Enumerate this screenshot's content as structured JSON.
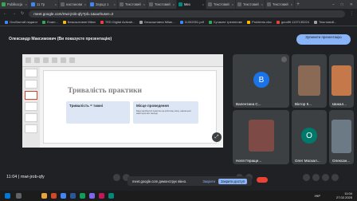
{
  "browser": {
    "tabs": [
      {
        "title": "Publikacja",
        "color": "#34a853"
      },
      {
        "title": "11 Тр",
        "color": "#4285f4"
      },
      {
        "title": "настанови",
        "color": "#5f6368"
      },
      {
        "title": "Зерщо 1",
        "color": "#4285f4"
      },
      {
        "title": "Текстовий",
        "color": "#5f6368"
      },
      {
        "title": "Текстовий",
        "color": "#5f6368"
      },
      {
        "title": "Мез",
        "color": "#00897b",
        "active": true
      },
      {
        "title": "Текстовий",
        "color": "#5f6368"
      },
      {
        "title": "Текстовий",
        "color": "#5f6368"
      },
      {
        "title": "Текстовий",
        "color": "#5f6368"
      }
    ],
    "url": "meet.google.com/mwi-jrob-qfy?pli=1&authuser=2",
    "bookmarks": [
      "Особистий педагог",
      "Exam...",
      "Безкоштовне Milan",
      "TED Digital Activati...",
      "Безкоштовна Milan...",
      "11002051.pdf",
      "Сучасне тренінгове",
      "Problems.xlsx",
      "goodfit 1137135224",
      "Текстовий..."
    ]
  },
  "banner": {
    "text": "Олександр Максимович (Ви показуєте презентацію)",
    "stop_button": "Зупинити презентацію"
  },
  "presentation": {
    "slide_title": "Тривалість практики",
    "card_left_title": "Тривалість = тижні",
    "card_right_title": "Місце проведення",
    "card_right_text": "База виробничої практики на робочому місці, навчальної майстерні або закладі"
  },
  "participants": [
    {
      "name": "Валентина С...",
      "type": "avatar",
      "letter": "B",
      "avatar_color": "#1a73e8"
    },
    {
      "name": "Віктор К...",
      "type": "photo",
      "photo_color": "#8a6a55"
    },
    {
      "name": "Шикал...",
      "type": "photo",
      "photo_color": "#c5784a"
    },
    {
      "name": "Неля Гераще...",
      "type": "photo",
      "photo_color": "#7d4a45"
    },
    {
      "name": "Олег Москал...",
      "type": "avatar",
      "letter": "O",
      "avatar_color": "#00796b"
    },
    {
      "name": "Олексан...",
      "type": "photo",
      "photo_color": "#6c7a86"
    }
  ],
  "controls": {
    "meeting_time": "11:04",
    "meeting_code": "mwi-jrob-qfy",
    "toast_text": "meet.google.com демонструє вікно.",
    "toast_link": "Закрити",
    "toast_button": "Закрити доступ"
  },
  "taskbar": {
    "time": "11:04",
    "date": "27.02.2025",
    "lang": "УКР"
  }
}
